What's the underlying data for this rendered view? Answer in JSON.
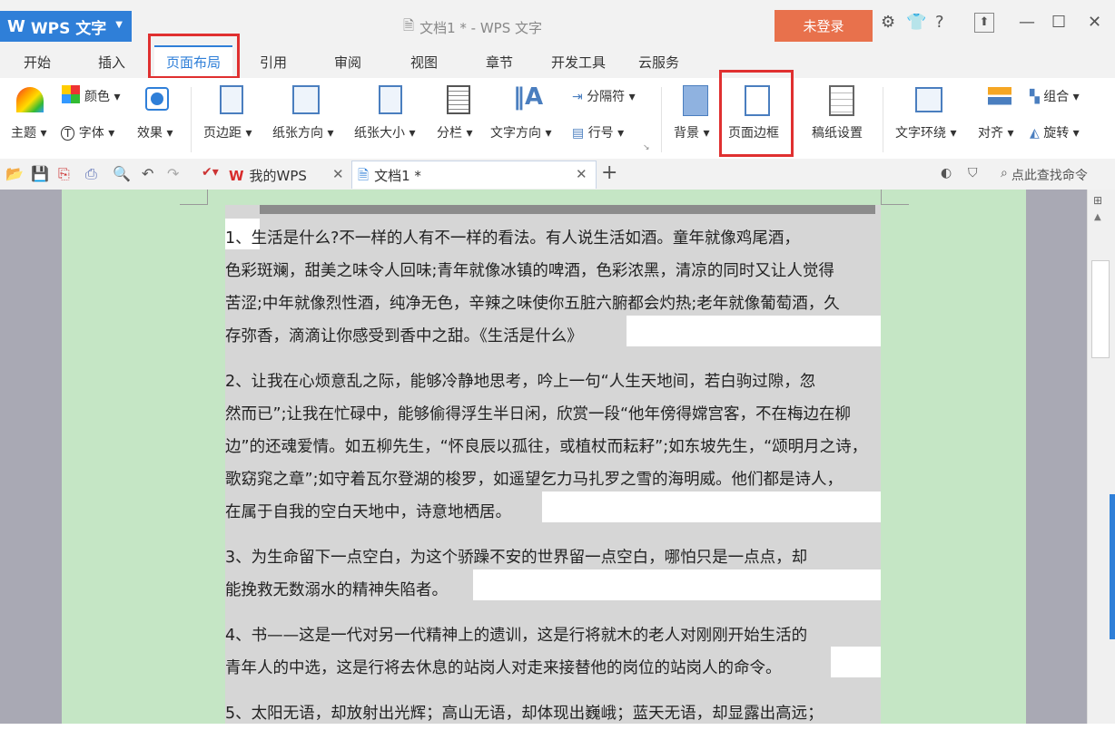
{
  "app": {
    "name": "WPS 文字",
    "window_title": "文档1 * - WPS 文字",
    "login_label": "未登录"
  },
  "tabs": [
    "开始",
    "插入",
    "页面布局",
    "引用",
    "审阅",
    "视图",
    "章节",
    "开发工具",
    "云服务"
  ],
  "active_tab": "页面布局",
  "ribbon": {
    "theme": "主题",
    "color": "颜色",
    "font": "字体",
    "effect": "效果",
    "margins": "页边距",
    "orientation": "纸张方向",
    "size": "纸张大小",
    "columns": "分栏",
    "text_direction": "文字方向",
    "separator": "分隔符",
    "line_number": "行号",
    "background": "背景",
    "page_border": "页面边框",
    "draft_paper": "稿纸设置",
    "text_wrap": "文字环绕",
    "align": "对齐",
    "group": "组合",
    "rotate": "旋转"
  },
  "quickbar": {
    "mywps_tab": "我的WPS",
    "doc_tab": "文档1 *",
    "search_placeholder": "点此查找命令"
  },
  "document": {
    "lines": [
      "    1、生活是什么?不一样的人有不一样的看法。有人说生活如酒。童年就像鸡尾酒，",
      "色彩斑斓，甜美之味令人回味;青年就像冰镇的啤酒，色彩浓黑，清凉的同时又让人觉得",
      "苦涩;中年就像烈性酒，纯净无色，辛辣之味使你五脏六腑都会灼热;老年就像葡萄酒，久",
      "存弥香，滴滴让你感受到香中之甜。《生活是什么》",
      "    2、让我在心烦意乱之际，能够冷静地思考，吟上一句“人生天地间，若白驹过隙，忽",
      "然而已”;让我在忙碌中，能够偷得浮生半日闲，欣赏一段“他年傍得嫦宫客，不在梅边在柳",
      "边”的还魂爱情。如五柳先生，“怀良辰以孤往，或植杖而耘耔”;如东坡先生，“颂明月之诗，",
      "歌窈窕之章”;如守着瓦尔登湖的梭罗，如遥望乞力马扎罗之雪的海明威。他们都是诗人，",
      "在属于自我的空白天地中，诗意地栖居。",
      "    3、为生命留下一点空白，为这个骄躁不安的世界留一点空白，哪怕只是一点点，却",
      "能挽救无数溺水的精神失陷者。",
      "    4、书——这是一代对另一代精神上的遗训，这是行将就木的老人对刚刚开始生活的",
      "青年人的中选，这是行将去休息的站岗人对走来接替他的岗位的站岗人的命令。",
      "    5、太阳无语，却放射出光辉；高山无语，却体现出巍峨；蓝天无语，却显露出高远；"
    ]
  },
  "colors": {
    "accent": "#2f7fd8",
    "highlight": "#e03030",
    "login": "#e8714c",
    "page_bg": "#c5e6c5",
    "selection": "#d6d6d6"
  }
}
